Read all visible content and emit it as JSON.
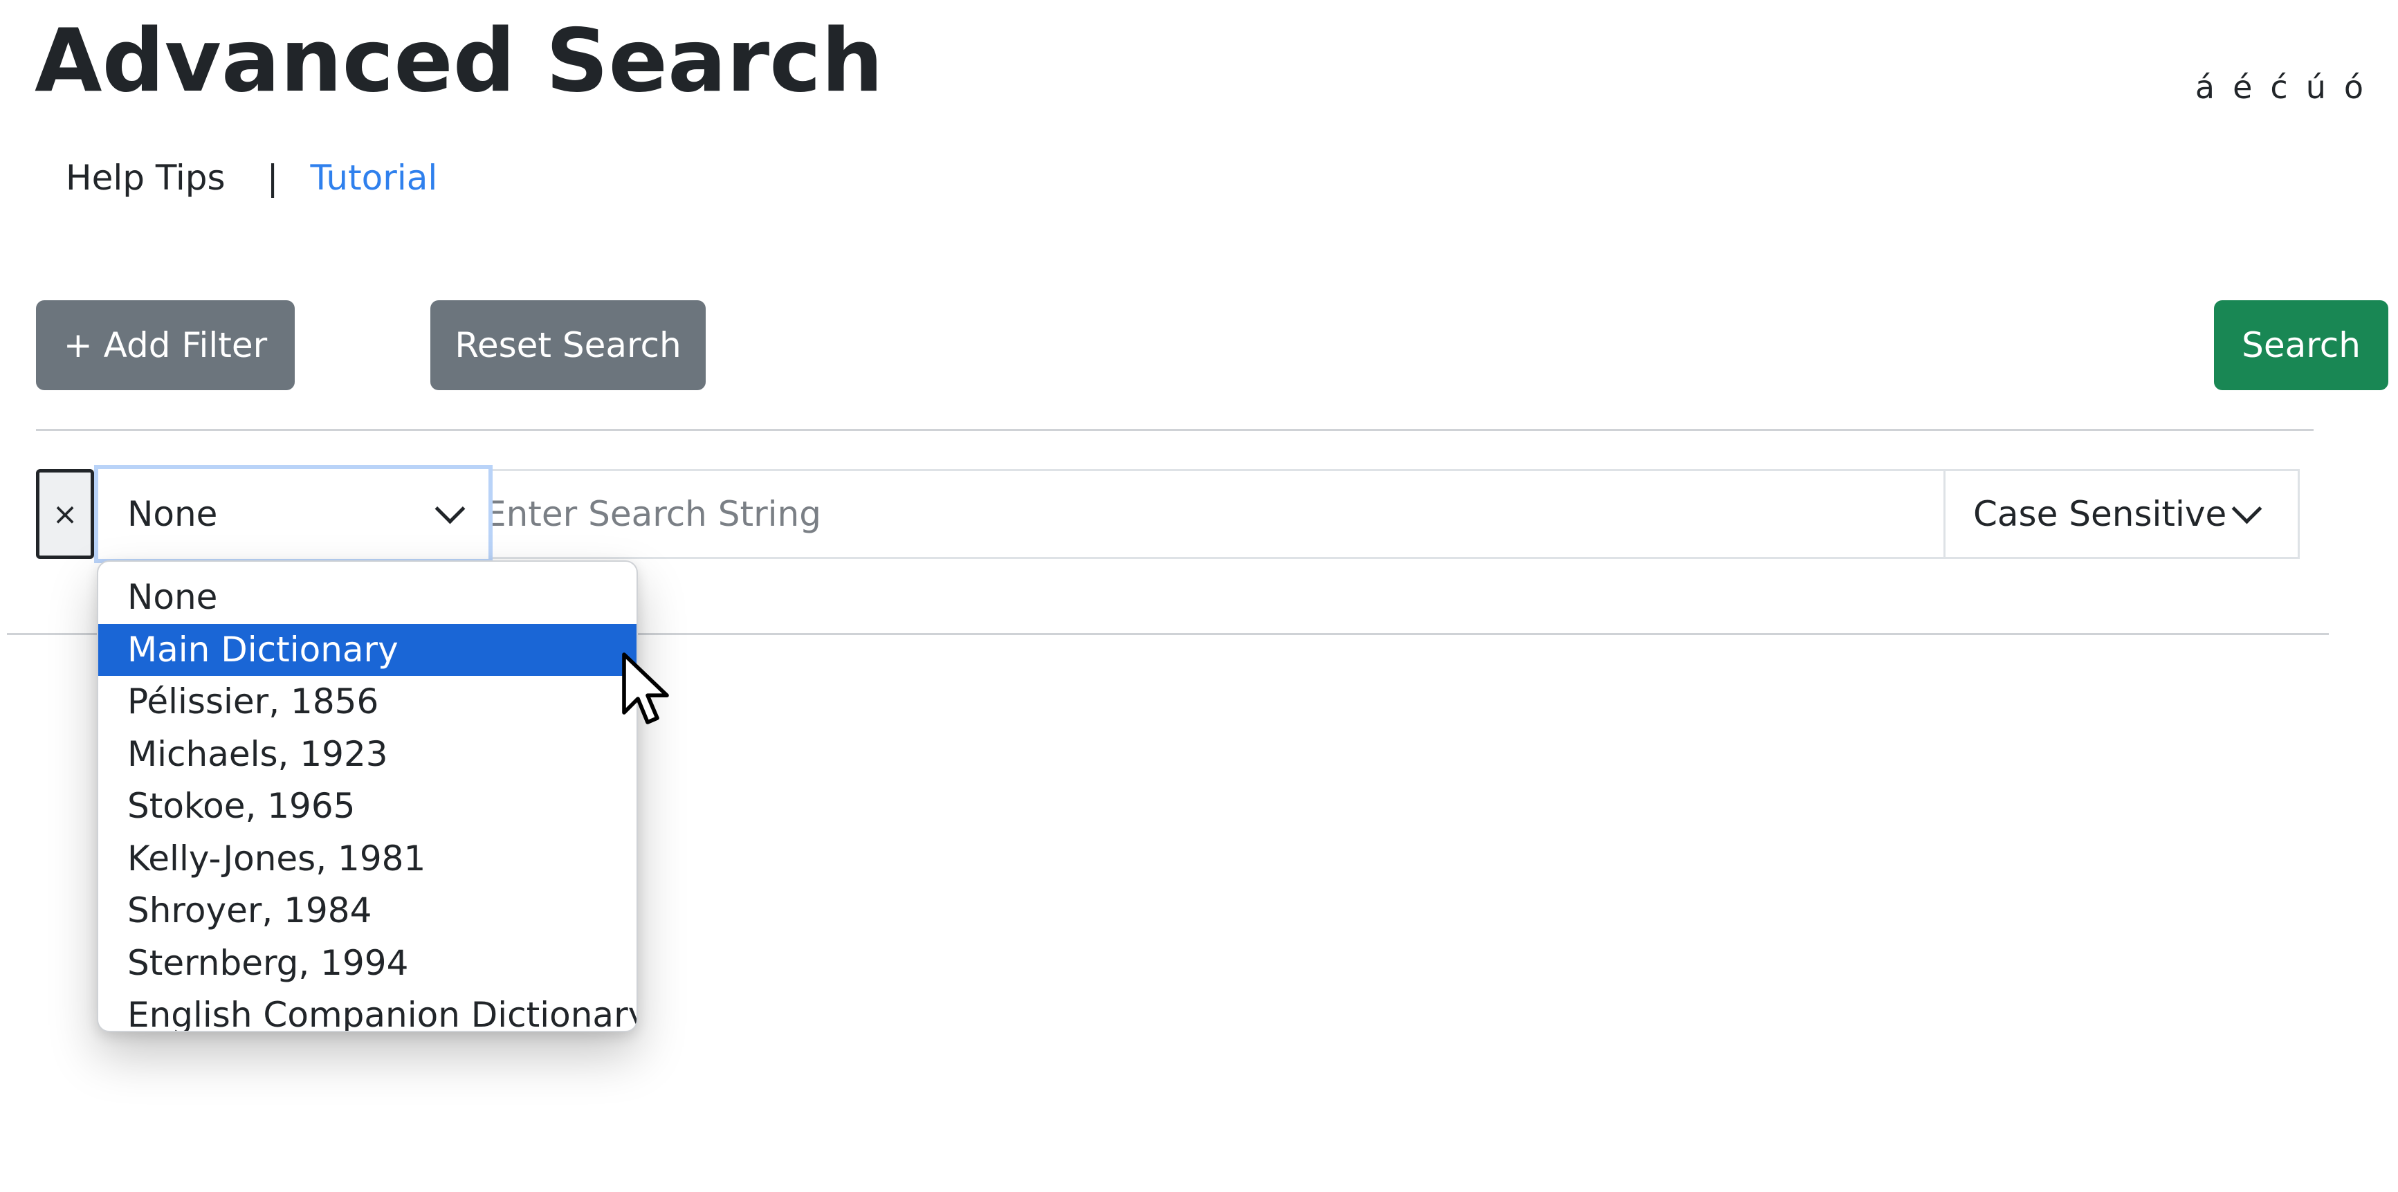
{
  "page": {
    "title": "Advanced Search"
  },
  "accent_chars": [
    "á",
    "é",
    "ć",
    "ú",
    "ó"
  ],
  "nav": {
    "help_tips": "Help Tips",
    "separator": "|",
    "tutorial": "Tutorial",
    "tutorial_color": "#2f80ed"
  },
  "toolbar": {
    "add_filter_label": "+ Add Filter",
    "reset_label": "Reset Search",
    "search_label": "Search",
    "search_color": "#198754",
    "secondary_color": "#6c757d"
  },
  "filter": {
    "remove_label": "×",
    "source_selected": "None",
    "search_placeholder": "Enter Search String",
    "search_value": "",
    "case_label": "Case Sensitive"
  },
  "dropdown": {
    "highlight_color": "#1a66d6",
    "highlighted": "Main Dictionary",
    "options": [
      "None",
      "Main Dictionary",
      "Pélissier, 1856",
      "Michaels, 1923",
      "Stokoe, 1965",
      "Kelly-Jones, 1981",
      "Shroyer, 1984",
      "Sternberg, 1994",
      "English Companion Dictionary"
    ]
  },
  "icons": {
    "chevron": "chevron-down-icon",
    "cursor": "mouse-pointer-icon"
  }
}
